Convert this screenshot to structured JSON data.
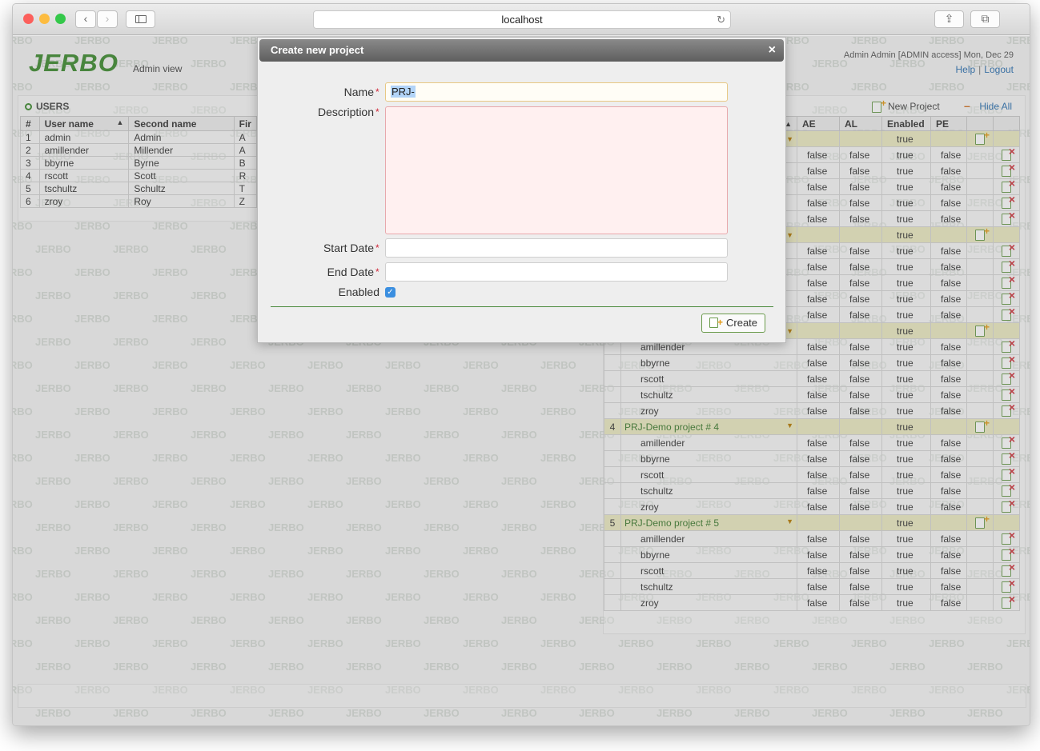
{
  "browser": {
    "url": "localhost",
    "traffic_colors": [
      "#fc605c",
      "#fdbc40",
      "#34c84a"
    ]
  },
  "app": {
    "logo": "JERBO",
    "view": "Admin view",
    "user_info": "Admin Admin   [ADMIN access]   Mon, Dec 29",
    "help": "Help",
    "logout": "Logout",
    "watermark": "JERBO",
    "accent": "#3b8a2e"
  },
  "users": {
    "title": "USERS",
    "columns": [
      "#",
      "User name",
      "Second name",
      "Fir"
    ],
    "rows": [
      [
        "1",
        "admin",
        "Admin",
        "A"
      ],
      [
        "2",
        "amillender",
        "Millender",
        "A"
      ],
      [
        "3",
        "bbyrne",
        "Byrne",
        "B"
      ],
      [
        "4",
        "rscott",
        "Scott",
        "R"
      ],
      [
        "5",
        "tschultz",
        "Schultz",
        "T"
      ],
      [
        "6",
        "zroy",
        "Roy",
        "Z"
      ]
    ]
  },
  "projects": {
    "new_project": "New Project",
    "hide_all": "Hide All",
    "columns": [
      "",
      "",
      "AE",
      "AL",
      "Enabled",
      "PE",
      "",
      ""
    ],
    "rows": [
      {
        "kind": "proj",
        "num": "",
        "name": "",
        "enabled": "true"
      },
      {
        "kind": "user",
        "name": "",
        "ae": "false",
        "al": "false",
        "en": "true",
        "pe": "false"
      },
      {
        "kind": "user",
        "name": "",
        "ae": "false",
        "al": "false",
        "en": "true",
        "pe": "false"
      },
      {
        "kind": "user",
        "name": "",
        "ae": "false",
        "al": "false",
        "en": "true",
        "pe": "false"
      },
      {
        "kind": "user",
        "name": "",
        "ae": "false",
        "al": "false",
        "en": "true",
        "pe": "false"
      },
      {
        "kind": "user",
        "name": "",
        "ae": "false",
        "al": "false",
        "en": "true",
        "pe": "false"
      },
      {
        "kind": "proj",
        "num": "",
        "name": "",
        "enabled": "true"
      },
      {
        "kind": "user",
        "name": "",
        "ae": "false",
        "al": "false",
        "en": "true",
        "pe": "false"
      },
      {
        "kind": "user",
        "name": "",
        "ae": "false",
        "al": "false",
        "en": "true",
        "pe": "false"
      },
      {
        "kind": "user",
        "name": "",
        "ae": "false",
        "al": "false",
        "en": "true",
        "pe": "false"
      },
      {
        "kind": "user",
        "name": "",
        "ae": "false",
        "al": "false",
        "en": "true",
        "pe": "false"
      },
      {
        "kind": "user",
        "name": "",
        "ae": "false",
        "al": "false",
        "en": "true",
        "pe": "false"
      },
      {
        "kind": "proj",
        "num": "",
        "name": "",
        "enabled": "true"
      },
      {
        "kind": "user",
        "name": "amillender",
        "ae": "false",
        "al": "false",
        "en": "true",
        "pe": "false"
      },
      {
        "kind": "user",
        "name": "bbyrne",
        "ae": "false",
        "al": "false",
        "en": "true",
        "pe": "false"
      },
      {
        "kind": "user",
        "name": "rscott",
        "ae": "false",
        "al": "false",
        "en": "true",
        "pe": "false"
      },
      {
        "kind": "user",
        "name": "tschultz",
        "ae": "false",
        "al": "false",
        "en": "true",
        "pe": "false"
      },
      {
        "kind": "user",
        "name": "zroy",
        "ae": "false",
        "al": "false",
        "en": "true",
        "pe": "false"
      },
      {
        "kind": "proj",
        "num": "4",
        "name": "PRJ-Demo project # 4",
        "enabled": "true"
      },
      {
        "kind": "user",
        "name": "amillender",
        "ae": "false",
        "al": "false",
        "en": "true",
        "pe": "false"
      },
      {
        "kind": "user",
        "name": "bbyrne",
        "ae": "false",
        "al": "false",
        "en": "true",
        "pe": "false"
      },
      {
        "kind": "user",
        "name": "rscott",
        "ae": "false",
        "al": "false",
        "en": "true",
        "pe": "false"
      },
      {
        "kind": "user",
        "name": "tschultz",
        "ae": "false",
        "al": "false",
        "en": "true",
        "pe": "false"
      },
      {
        "kind": "user",
        "name": "zroy",
        "ae": "false",
        "al": "false",
        "en": "true",
        "pe": "false"
      },
      {
        "kind": "proj",
        "num": "5",
        "name": "PRJ-Demo project # 5",
        "enabled": "true"
      },
      {
        "kind": "user",
        "name": "amillender",
        "ae": "false",
        "al": "false",
        "en": "true",
        "pe": "false"
      },
      {
        "kind": "user",
        "name": "bbyrne",
        "ae": "false",
        "al": "false",
        "en": "true",
        "pe": "false"
      },
      {
        "kind": "user",
        "name": "rscott",
        "ae": "false",
        "al": "false",
        "en": "true",
        "pe": "false"
      },
      {
        "kind": "user",
        "name": "tschultz",
        "ae": "false",
        "al": "false",
        "en": "true",
        "pe": "false"
      },
      {
        "kind": "user",
        "name": "zroy",
        "ae": "false",
        "al": "false",
        "en": "true",
        "pe": "false"
      }
    ]
  },
  "dialog": {
    "title": "Create new project",
    "close": "×",
    "name_label": "Name",
    "name_value": "PRJ-",
    "description_label": "Description",
    "description_value": "",
    "start_label": "Start Date",
    "start_value": "",
    "end_label": "End Date",
    "end_value": "",
    "enabled_label": "Enabled",
    "enabled_checked": true,
    "required_mark": "*",
    "create_label": "Create"
  }
}
